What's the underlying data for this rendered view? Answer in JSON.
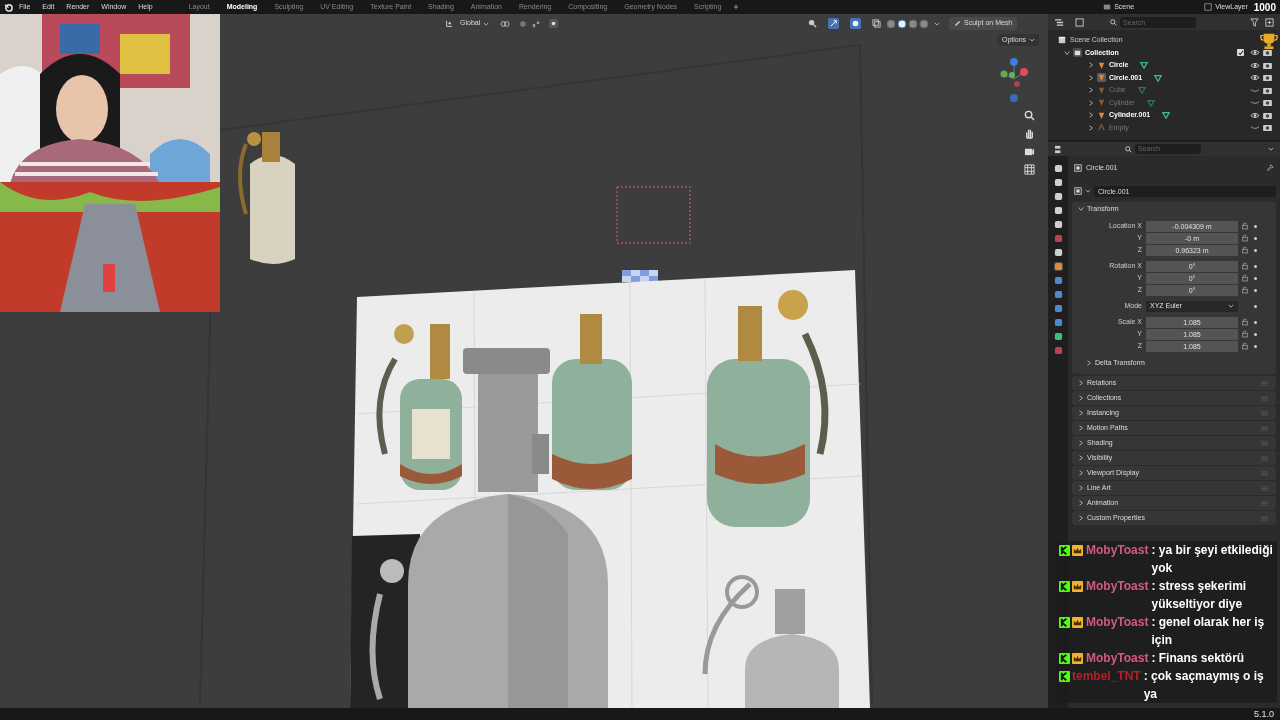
{
  "menu_bar": {
    "menus": [
      "File",
      "Edit",
      "Render",
      "Window",
      "Help"
    ],
    "workspaces": [
      {
        "label": "Layout",
        "selected": false
      },
      {
        "label": "Modeling",
        "selected": true
      },
      {
        "label": "Sculpting",
        "selected": false
      },
      {
        "label": "UV Editing",
        "selected": false
      },
      {
        "label": "Texture Paint",
        "selected": false
      },
      {
        "label": "Shading",
        "selected": false
      },
      {
        "label": "Animation",
        "selected": false
      },
      {
        "label": "Rendering",
        "selected": false
      },
      {
        "label": "Compositing",
        "selected": false
      },
      {
        "label": "Geometry Nodes",
        "selected": false
      },
      {
        "label": "Scripting",
        "selected": false
      }
    ]
  },
  "top_right": {
    "scene": "Scene",
    "view_layer": "ViewLayer",
    "counter": "1000"
  },
  "viewport_header": {
    "orientation": "Global",
    "shading_modes": [
      {
        "selected": false
      },
      {
        "selected": true
      },
      {
        "selected": false
      },
      {
        "selected": false
      }
    ],
    "sculpt_button": "Sculpt on Mesh",
    "options": "Options"
  },
  "outliner": {
    "search_placeholder": "Search",
    "root": "Scene Collection",
    "collection": {
      "label": "Collection",
      "checked": true,
      "expanded": true,
      "children": [
        {
          "label": "Circle",
          "kind": "mesh",
          "visible": true,
          "selected": false
        },
        {
          "label": "Circle.001",
          "kind": "mesh",
          "visible": true,
          "selected": true
        },
        {
          "label": "Cube",
          "kind": "mesh",
          "visible": false,
          "selected": false
        },
        {
          "label": "Cylinder",
          "kind": "mesh",
          "visible": false,
          "selected": false
        },
        {
          "label": "Cylinder.001",
          "kind": "mesh",
          "visible": true,
          "selected": false
        },
        {
          "label": "Empty",
          "kind": "empty",
          "visible": false,
          "selected": false
        }
      ]
    }
  },
  "properties": {
    "search_placeholder": "Search",
    "object_name": "Circle.001",
    "data_name": "Circle.001",
    "transform": {
      "title": "Transform",
      "expanded": true,
      "groups": [
        {
          "rows": [
            {
              "kind": "number",
              "label": "Location X",
              "value": "-0.004309 m"
            },
            {
              "kind": "number",
              "label": "Y",
              "value": "-0 m"
            },
            {
              "kind": "number",
              "label": "Z",
              "value": "0.96323 m"
            }
          ]
        },
        {
          "rows": [
            {
              "kind": "number",
              "label": "Rotation X",
              "value": "0°"
            },
            {
              "kind": "number",
              "label": "Y",
              "value": "0°"
            },
            {
              "kind": "number",
              "label": "Z",
              "value": "0°"
            }
          ]
        },
        {
          "rows": [
            {
              "kind": "dropdown",
              "label": "Mode",
              "value": "XYZ Euler"
            }
          ]
        },
        {
          "rows": [
            {
              "kind": "number",
              "label": "Scale X",
              "value": "1.085"
            },
            {
              "kind": "number",
              "label": "Y",
              "value": "1.085"
            },
            {
              "kind": "number",
              "label": "Z",
              "value": "1.085"
            }
          ]
        }
      ],
      "subpanels": [
        {
          "title": "Delta Transform",
          "expanded": false
        }
      ]
    },
    "panels": [
      {
        "title": "Relations",
        "expanded": false
      },
      {
        "title": "Collections",
        "expanded": false
      },
      {
        "title": "Instancing",
        "expanded": false
      },
      {
        "title": "Motion Paths",
        "expanded": false
      },
      {
        "title": "Shading",
        "expanded": false
      },
      {
        "title": "Visibility",
        "expanded": false
      },
      {
        "title": "Viewport Display",
        "expanded": false
      },
      {
        "title": "Line Art",
        "expanded": false
      },
      {
        "title": "Animation",
        "expanded": false
      },
      {
        "title": "Custom Properties",
        "expanded": false
      }
    ]
  },
  "chat": [
    {
      "user": "MobyToast",
      "color": "#d6588a",
      "crown": true,
      "text": ": ya bir şeyi etkilediği yok"
    },
    {
      "user": "MobyToast",
      "color": "#d6588a",
      "crown": true,
      "text": ": stress şekerimi yükseltiyor diye"
    },
    {
      "user": "MobyToast",
      "color": "#d6588a",
      "crown": true,
      "text": ": genel olarak her iş için"
    },
    {
      "user": "MobyToast",
      "color": "#d6588a",
      "crown": true,
      "text": ": Finans sektörü"
    },
    {
      "user": "tembel_TNT",
      "color": "#b3212b",
      "crown": false,
      "text": ": çok saçmaymış o iş ya"
    }
  ],
  "version": "5.1.0"
}
